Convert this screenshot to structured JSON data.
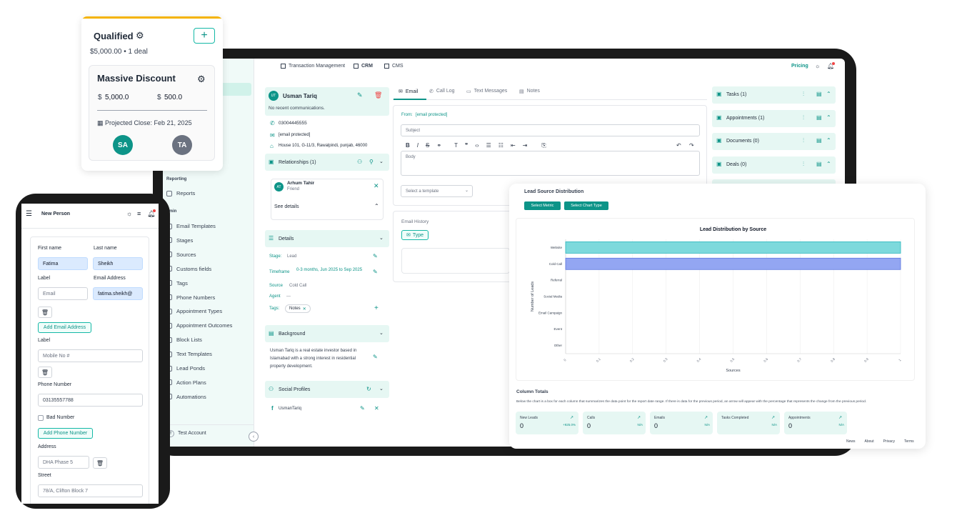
{
  "qualified_card": {
    "title": "Qualified",
    "summary": "$5,000.00 • 1 deal",
    "deal_title": "Massive Discount",
    "amount1": "5,000.0",
    "amount2": "500.0",
    "currency": "$",
    "projected_close": "Projected Close: Feb 21, 2025",
    "avatars": [
      "SA",
      "TA"
    ]
  },
  "topbar": {
    "tabs": [
      "Transaction Management",
      "CRM",
      "CMS"
    ],
    "pricing": "Pricing"
  },
  "sidebar": {
    "section_reporting": "Reporting",
    "reports": "Reports",
    "section_admin": "dmin",
    "items": [
      "Email Templates",
      "Stages",
      "Sources",
      "Customs fields",
      "Tags",
      "Phone Numbers",
      "Appointment Types",
      "Appointment Outcomes",
      "Block Lists",
      "Text Templates",
      "Lead Ponds",
      "Action Plans",
      "Automations"
    ],
    "account_initial": "T",
    "account": "Test Account"
  },
  "contact": {
    "initials": "UT",
    "name": "Usman Tariq",
    "no_comm": "No recent communications.",
    "phone": "03004445555",
    "email": "[email protected]",
    "address": "House 101, G-11/3, Rawalpindi, punjab, 46000",
    "relationships_title": "Relationships (1)",
    "rel_initials": "AT",
    "rel_name": "Arhum Tahir",
    "rel_type": "Friend",
    "see_details": "See details",
    "details_title": "Details",
    "stage_label": "Stage:",
    "stage_value": "Lead",
    "timeframe_label": "Timeframe",
    "timeframe_value": "0-3 months, Jun 2025 to Sep 2025",
    "source_label": "Source",
    "source_value": "Cold Call",
    "agent_label": "Agent",
    "agent_value": "---",
    "tags_label": "Tags:",
    "tag": "Notes",
    "background_title": "Background",
    "background_text": "Usman Tariq is a real estate investor based in Islamabad with a strong interest in residential property development.",
    "social_title": "Social Profiles",
    "social_handle": "UsmanTariq"
  },
  "compose": {
    "tabs": [
      "Email",
      "Call Log",
      "Text Messages",
      "Notes"
    ],
    "from_label": "From:",
    "from_value": "[email protected]",
    "subject_placeholder": "Subject",
    "body_placeholder": "Body",
    "template_placeholder": "Select a template",
    "history_title": "Email History",
    "type_button": "Type"
  },
  "right_panels": [
    {
      "label": "Tasks (1)"
    },
    {
      "label": "Appointments (1)"
    },
    {
      "label": "Documents (0)"
    },
    {
      "label": "Deals (0)"
    }
  ],
  "report": {
    "title": "Lead Source Distribution",
    "select_metric": "Select Metric",
    "select_chart_type": "Select Chart Type",
    "column_totals_title": "Column Totals",
    "column_totals_desc": "Below the chart is a box for each column that summarizes the data point for the report date range. If there is data for the previous period, an arrow will appear with the percentage that represents the change from the previous period.",
    "totals": [
      {
        "label": "New Leads",
        "value": "0",
        "change": "+925.0%"
      },
      {
        "label": "Calls",
        "value": "0",
        "change": "N/A"
      },
      {
        "label": "Emails",
        "value": "0",
        "change": "N/A"
      },
      {
        "label": "Tasks Completed",
        "value": "",
        "change": "N/A"
      },
      {
        "label": "Appointments",
        "value": "0",
        "change": "N/A"
      }
    ],
    "footer_links": [
      "News",
      "About",
      "Privacy",
      "Terms"
    ]
  },
  "chart_data": {
    "type": "bar",
    "orientation": "horizontal",
    "title": "Lead Distribution by Source",
    "xlabel": "Sources",
    "ylabel": "Number of Leads",
    "categories": [
      "Website",
      "Cold Call",
      "Referral",
      "Social Media",
      "Email Campaign",
      "Event",
      "Other"
    ],
    "values": [
      1,
      1,
      0,
      0,
      0,
      0,
      0
    ],
    "xlim": [
      0,
      1
    ],
    "ticks": [
      "0",
      "0.1",
      "0.2",
      "0.3",
      "0.4",
      "0.5",
      "0.6",
      "0.7",
      "0.8",
      "0.9",
      "1"
    ],
    "bar_colors": [
      "#7dd9dc",
      "#93a6f2"
    ],
    "grid": true
  },
  "phone": {
    "title": "New Person",
    "first_name_label": "First name",
    "last_name_label": "Last name",
    "first_name": "Fatima",
    "last_name": "Sheikh",
    "label_label": "Label",
    "email_address_label": "Email Address",
    "email_placeholder": "Email",
    "email_value": "fatima.sheikh@",
    "add_email": "Add Email Address",
    "label2": "Label",
    "mobile_placeholder": "Mobile No #",
    "phone_number_label": "Phone Number",
    "phone_number": "03135557788",
    "bad_number": "Bad Number",
    "add_phone": "Add Phone Number",
    "address_label": "Address",
    "address_value": "DHA Phase 5",
    "street_label": "Street",
    "street_value": "78/A, Clifton Block 7"
  },
  "colors": {
    "accent": "#0d9488",
    "panel": "#e6f7f3",
    "amber": "#f5b301"
  }
}
